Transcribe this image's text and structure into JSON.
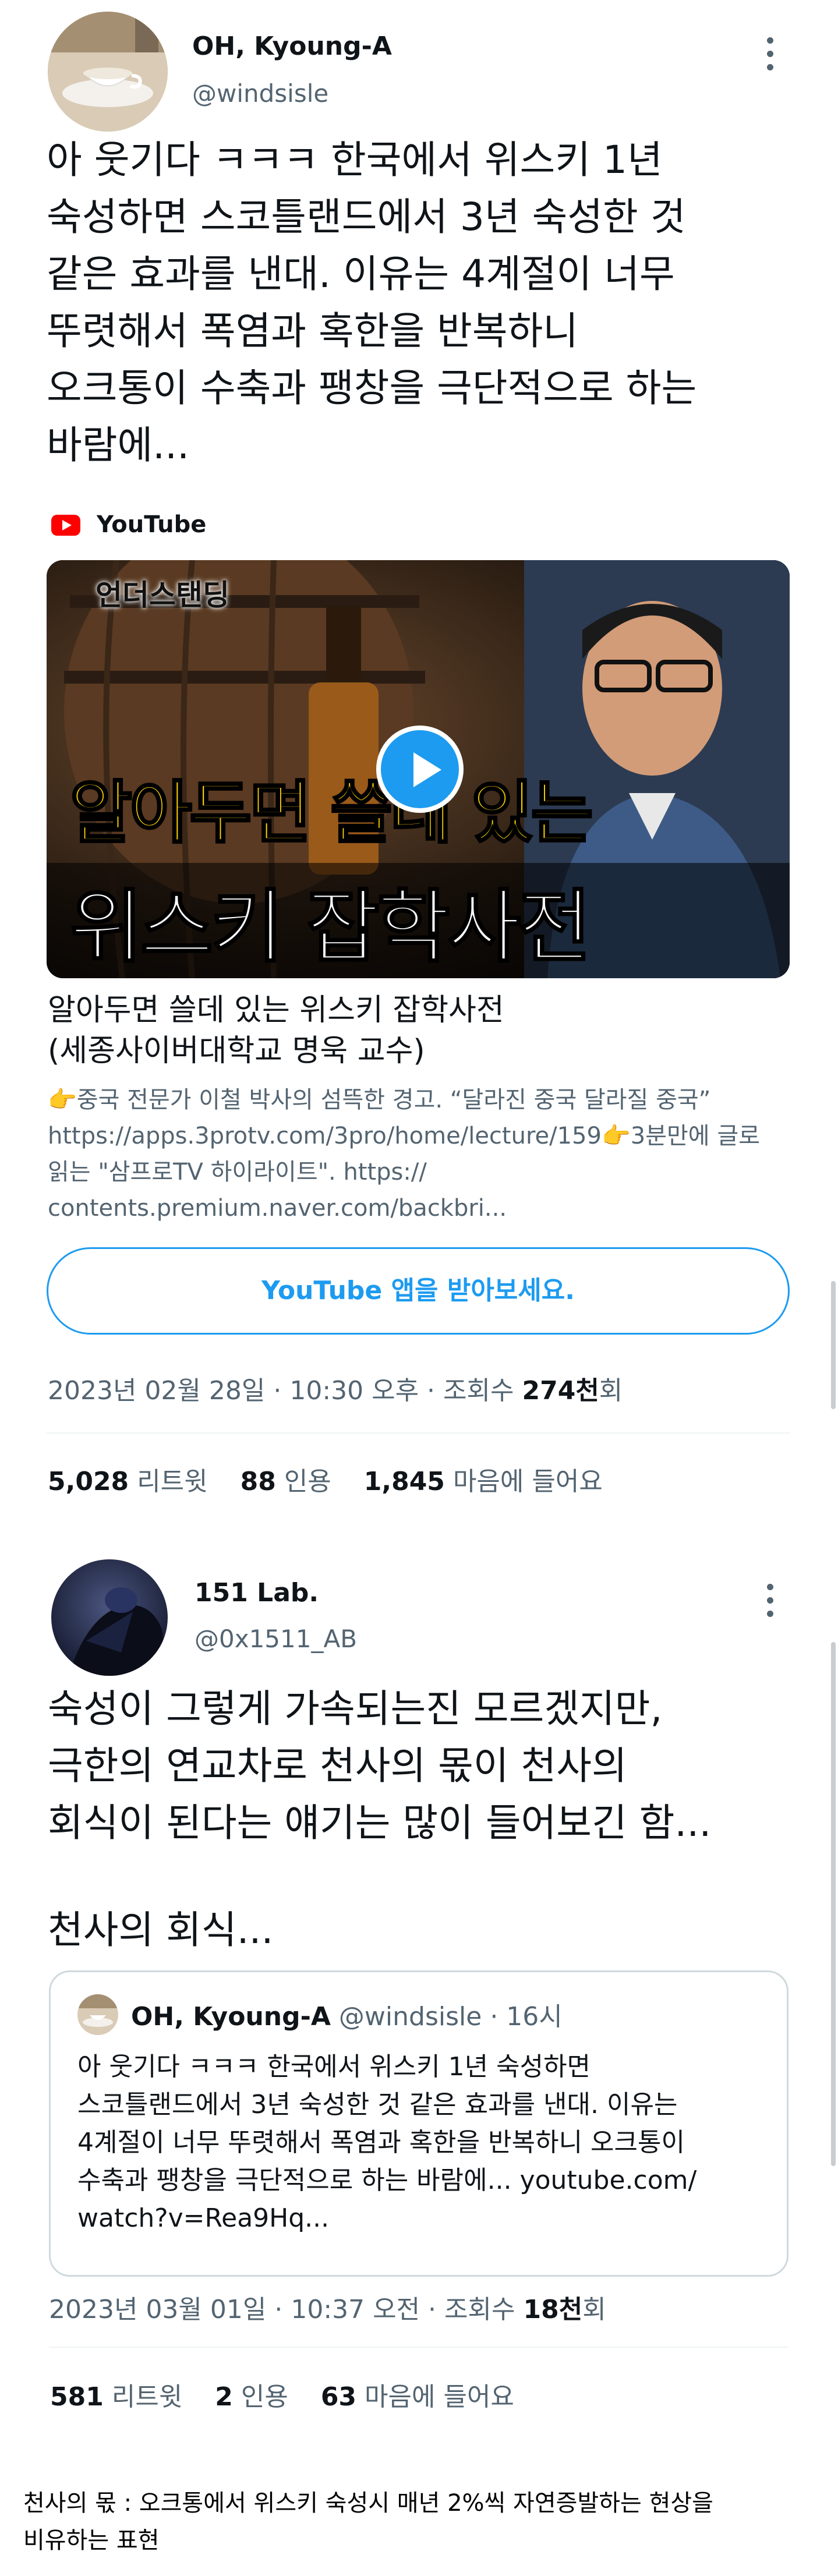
{
  "tweet1": {
    "author_name": "OH, Kyoung-A",
    "author_handle": "@windsisle",
    "text": "아 웃기다 ㅋㅋㅋ 한국에서 위스키 1년\n숙성하면 스코틀랜드에서 3년 숙성한 것\n같은 효과를 낸대. 이유는 4계절이 너무\n뚜렷해서 폭염과 혹한을 반복하니\n오크통이 수축과 팽창을 극단적으로 하는\n바람에...",
    "card": {
      "source": "YouTube",
      "thumb_tag": "언더스탠딩",
      "thumb_line1": "알아두면 쓸데 있는",
      "thumb_line2": "위스키 잡학사전",
      "title": "알아두면 쓸데 있는 위스키 잡학사전\n(세종사이버대학교 명욱 교수)",
      "desc_line1": "👉중국 전문가 이철 박사의 섬뜩한 경고. “달라진 중국 달라질 중국”",
      "desc_line2": "https://apps.3protv.com/3pro/home/lecture/159👉3분만에 글로",
      "desc_line3": "읽는 \"삼프로TV 하이라이트\". https://",
      "desc_line4": "contents.premium.naver.com/backbri...",
      "button_label": "YouTube 앱을 받아보세요."
    },
    "timestamp": "2023년 02월 28일 · 10:30 오후 · 조회수 ",
    "views": "274천",
    "views_suffix": "회",
    "retweets": "5,028",
    "retweets_label": "리트윗",
    "quotes": "88",
    "quotes_label": "인용",
    "likes": "1,845",
    "likes_label": "마음에 들어요"
  },
  "tweet2": {
    "author_name": "151 Lab.",
    "author_handle": "@0x1511_AB",
    "text": "숙성이 그렇게 가속되는진 모르겠지만,\n극한의 연교차로 천사의 몫이 천사의\n회식이 된다는 얘기는 많이 들어보긴 함...",
    "text2": "천사의 회식...",
    "quote": {
      "author_name": "OH, Kyoung-A",
      "author_handle": "@windsisle",
      "time": "· 16시",
      "text": "아 웃기다 ㅋㅋㅋ 한국에서 위스키 1년 숙성하면\n스코틀랜드에서 3년 숙성한 것 같은 효과를 낸대. 이유는\n4계절이 너무 뚜렷해서 폭염과 혹한을 반복하니 오크통이\n수축과 팽창을 극단적으로 하는 바람에... youtube.com/\nwatch?v=Rea9Hq..."
    },
    "timestamp": "2023년 03월 01일 · 10:37 오전 · 조회수 ",
    "views": "18천",
    "views_suffix": "회",
    "retweets": "581",
    "retweets_label": "리트윗",
    "quotes": "2",
    "quotes_label": "인용",
    "likes": "63",
    "likes_label": "마음에 들어요"
  },
  "footnote": {
    "line1": "천사의 몫 : 오크통에서 위스키 숙성시 매년 2%씩 자연증발하는 현상을",
    "line2": "비유하는 표현"
  },
  "colors": {
    "accent": "#1d9bf0",
    "youtube_red": "#ff0000",
    "text": "#0f1419",
    "muted": "#536471",
    "thumb_yellow": "#ffd400"
  }
}
